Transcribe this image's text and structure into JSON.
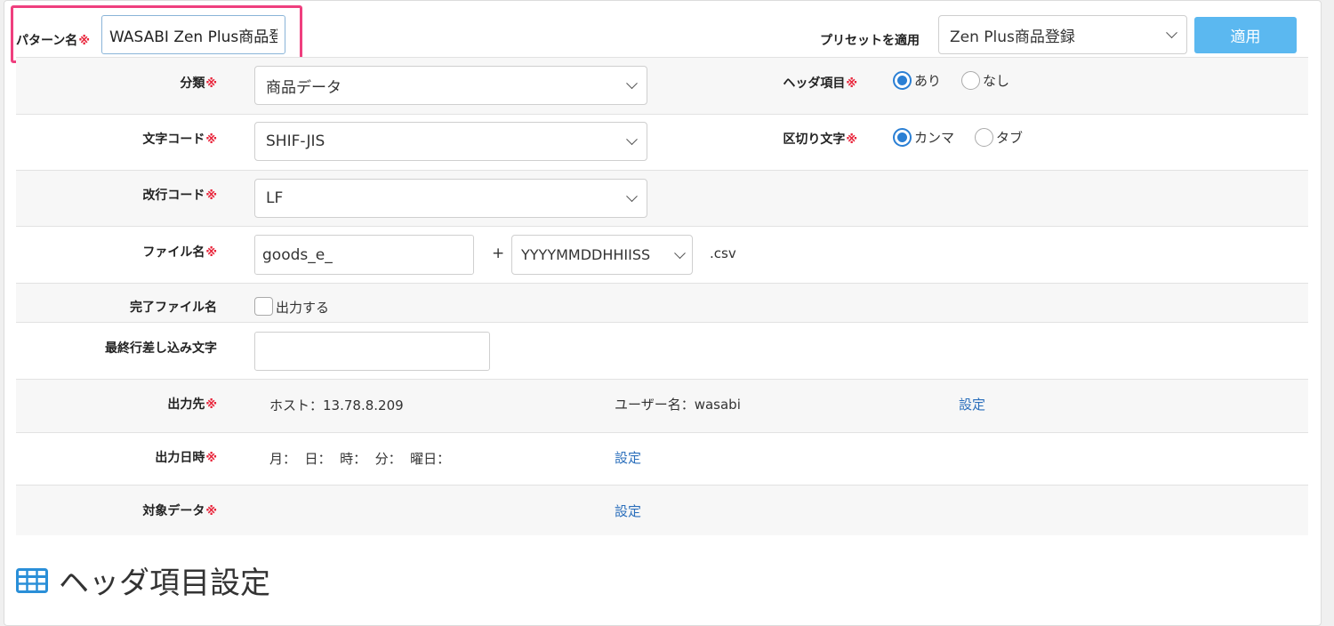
{
  "pattern": {
    "label": "パターン名",
    "required_mark": "※",
    "value": "WASABI Zen Plus商品登録"
  },
  "preset": {
    "label": "プリセットを適用",
    "selected": "Zen Plus商品登録",
    "apply_button": "適用"
  },
  "form": {
    "classification": {
      "label": "分類",
      "required_mark": "※",
      "selected": "商品データ"
    },
    "header_item": {
      "label": "ヘッダ項目",
      "required_mark": "※",
      "options": [
        "あり",
        "なし"
      ],
      "selected_index": 0
    },
    "char_code": {
      "label": "文字コード",
      "required_mark": "※",
      "selected": "SHIF-JIS"
    },
    "delimiter": {
      "label": "区切り文字",
      "required_mark": "※",
      "options": [
        "カンマ",
        "タブ"
      ],
      "selected_index": 0
    },
    "newline_code": {
      "label": "改行コード",
      "required_mark": "※",
      "selected": "LF"
    },
    "file_name": {
      "label": "ファイル名",
      "required_mark": "※",
      "prefix": "goods_e_",
      "plus": "+",
      "date_format": "YYYYMMDDHHIISS",
      "extension": ".csv"
    },
    "complete_file": {
      "label": "完了ファイル名",
      "checkbox_label": "出力する",
      "checked": false
    },
    "last_line": {
      "label": "最終行差し込み文字",
      "value": ""
    },
    "destination": {
      "label": "出力先",
      "required_mark": "※",
      "host": "ホスト：13.78.8.209",
      "user": "ユーザー名：wasabi",
      "setting_link": "設定"
    },
    "output_datetime": {
      "label": "出力日時",
      "required_mark": "※",
      "schedule": "月：  日：  時：  分：  曜日：",
      "setting_link": "設定"
    },
    "target_data": {
      "label": "対象データ",
      "required_mark": "※",
      "setting_link": "設定"
    }
  },
  "section": {
    "title": "ヘッダ項目設定",
    "icon": "table-icon",
    "icon_color": "#2a8fd8"
  },
  "colors": {
    "required": "#e8243a",
    "highlight": "#ef3f7e",
    "apply_button": "#5bb8f0",
    "radio_selected": "#2a7fd4",
    "link": "#2a6ebb"
  }
}
